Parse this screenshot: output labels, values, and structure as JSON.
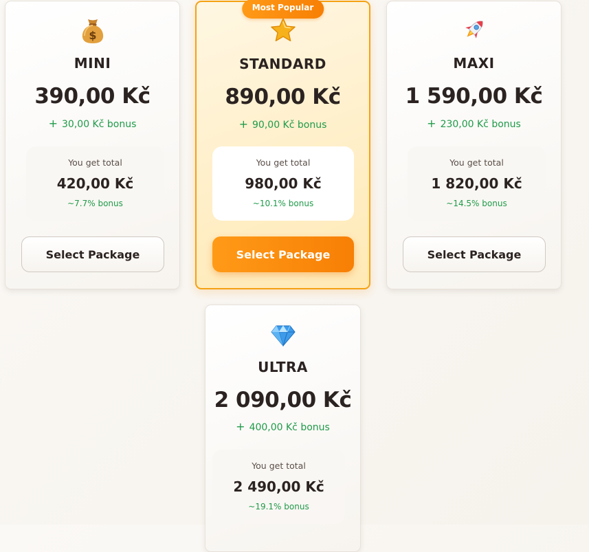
{
  "packages": [
    {
      "icon": "money-bag-icon",
      "name": "MINI",
      "price": "390,00 Kč",
      "bonus": "30,00 Kč bonus",
      "total_caption": "You get total",
      "total": "420,00 Kč",
      "total_pct": "~7.7% bonus",
      "button": "Select Package"
    },
    {
      "icon": "star-icon",
      "badge": "Most Popular",
      "name": "STANDARD",
      "price": "890,00 Kč",
      "bonus": "90,00 Kč bonus",
      "total_caption": "You get total",
      "total": "980,00 Kč",
      "total_pct": "~10.1% bonus",
      "button": "Select Package"
    },
    {
      "icon": "rocket-icon",
      "name": "MAXI",
      "price": "1 590,00 Kč",
      "bonus": "230,00 Kč bonus",
      "total_caption": "You get total",
      "total": "1 820,00 Kč",
      "total_pct": "~14.5% bonus",
      "button": "Select Package"
    },
    {
      "icon": "diamond-icon",
      "name": "ULTRA",
      "price": "2 090,00 Kč",
      "bonus": "400,00 Kč bonus",
      "total_caption": "You get total",
      "total": "2 490,00 Kč",
      "total_pct": "~19.1% bonus"
    }
  ],
  "colors": {
    "accent": "#f7880c",
    "accent_light": "#ffe9b5",
    "bonus_green": "#1f9a49",
    "text": "#2b2321"
  }
}
